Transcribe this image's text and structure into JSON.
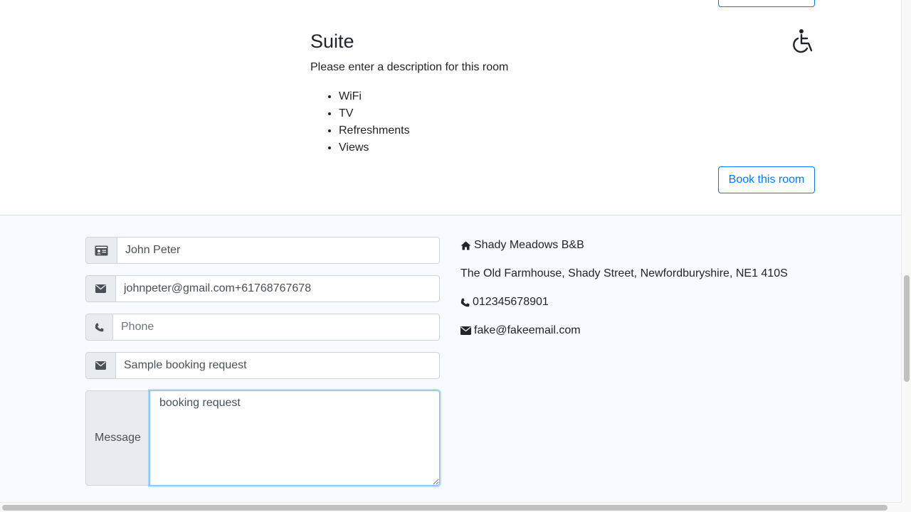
{
  "room": {
    "title": "Suite",
    "description": "Please enter a description for this room",
    "features": [
      "WiFi",
      "TV",
      "Refreshments",
      "Views"
    ],
    "book_label": "Book this room",
    "accessibility_icon": "wheelchair-icon"
  },
  "contact_form": {
    "name": {
      "icon": "id-card-icon",
      "value": "John Peter"
    },
    "email": {
      "icon": "envelope-icon",
      "value": "johnpeter@gmail.com+61768767678"
    },
    "phone": {
      "icon": "phone-icon",
      "placeholder": "Phone"
    },
    "subject": {
      "icon": "envelope-icon",
      "value": "Sample booking request"
    },
    "message": {
      "label": "Message",
      "value": "booking request"
    }
  },
  "contact_info": {
    "name": "Shady Meadows B&B",
    "address": "The Old Farmhouse, Shady Street, Newfordburyshire, NE1 410S",
    "phone": "012345678901",
    "email": "fake@fakeemail.com"
  },
  "colors": {
    "primary": "#007bff",
    "contact_background": "#f7fbff",
    "addon_background": "#e9ecef"
  }
}
